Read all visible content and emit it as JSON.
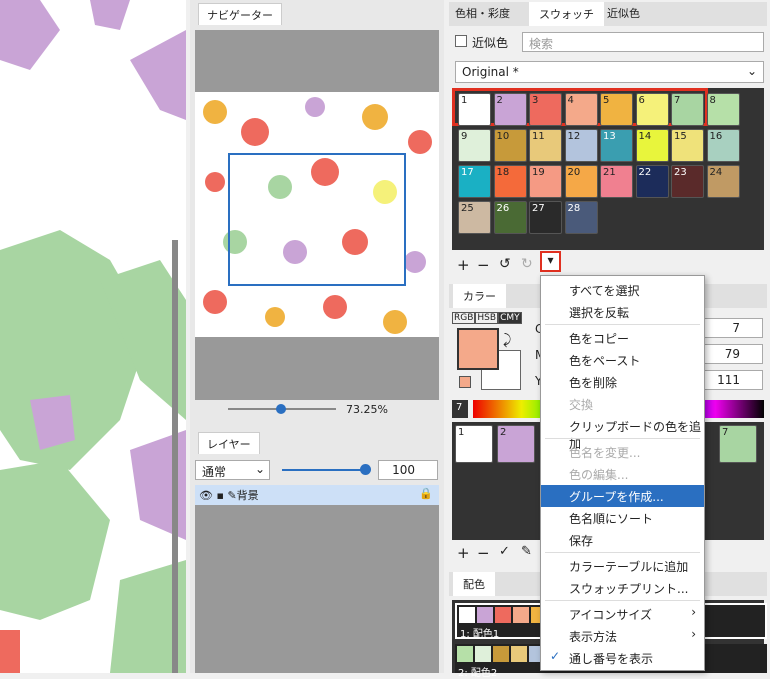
{
  "nav": {
    "tab": "ナビゲーター",
    "zoom": "73.25%"
  },
  "layer": {
    "tab": "レイヤー",
    "blend": "通常",
    "opacity": "100",
    "name": "背景"
  },
  "right_tabs": [
    "色相・彩度",
    "スウォッチ",
    "近似色"
  ],
  "approx": {
    "label": "近似色",
    "search_placeholder": "検索",
    "set": "Original *"
  },
  "swatches": [
    {
      "n": "1",
      "c": "#ffffff"
    },
    {
      "n": "2",
      "c": "#c9a4d6"
    },
    {
      "n": "3",
      "c": "#ee6a5e"
    },
    {
      "n": "4",
      "c": "#f4a98a"
    },
    {
      "n": "5",
      "c": "#f0b341"
    },
    {
      "n": "6",
      "c": "#f5f17a"
    },
    {
      "n": "7",
      "c": "#a8d5a2"
    },
    {
      "n": "8",
      "c": "#b6e0a8"
    },
    {
      "n": "9",
      "c": "#dff0da"
    },
    {
      "n": "10",
      "c": "#c79a3a"
    },
    {
      "n": "11",
      "c": "#e8c97a"
    },
    {
      "n": "12",
      "c": "#b3c4dd"
    },
    {
      "n": "13",
      "c": "#3a9eb0"
    },
    {
      "n": "14",
      "c": "#e8f53c"
    },
    {
      "n": "15",
      "c": "#efe27a"
    },
    {
      "n": "16",
      "c": "#a8d0c0"
    },
    {
      "n": "17",
      "c": "#1ab0c4"
    },
    {
      "n": "18",
      "c": "#f46a3a"
    },
    {
      "n": "19",
      "c": "#f59a84"
    },
    {
      "n": "20",
      "c": "#f5a847"
    },
    {
      "n": "21",
      "c": "#f08090"
    },
    {
      "n": "22",
      "c": "#1c2c5a"
    },
    {
      "n": "23",
      "c": "#5a2a2a"
    },
    {
      "n": "24",
      "c": "#c09a64"
    },
    {
      "n": "25",
      "c": "#cdb9a2"
    },
    {
      "n": "26",
      "c": "#4a6a34"
    },
    {
      "n": "27",
      "c": "#2a2a2a"
    },
    {
      "n": "28",
      "c": "#4a5a7a"
    }
  ],
  "color": {
    "tab": "カラー",
    "modes": [
      "RGB",
      "HSB",
      "CMY"
    ],
    "val1": "7",
    "val2": "79",
    "val3": "111",
    "label1": "C",
    "label2": "M",
    "label3": "Y",
    "seven": "7"
  },
  "recent": [
    {
      "n": "1",
      "c": "#ffffff"
    },
    {
      "n": "2",
      "c": "#c9a4d6"
    },
    {
      "n": "7",
      "c": "#a8d5a2"
    }
  ],
  "haishoku": {
    "tab": "配色",
    "row1": "1: 配色1",
    "row2": "2: 配色2"
  },
  "menu": [
    {
      "t": "すべてを選択",
      "s": ""
    },
    {
      "t": "選択を反転",
      "s": ""
    },
    {
      "t": "色をコピー",
      "s": ""
    },
    {
      "t": "色をペースト",
      "s": ""
    },
    {
      "t": "色を削除",
      "s": ""
    },
    {
      "t": "交換",
      "s": "dis"
    },
    {
      "t": "クリップボードの色を追加",
      "s": ""
    },
    {
      "t": "色名を変更...",
      "s": "dis"
    },
    {
      "t": "色の編集...",
      "s": "dis"
    },
    {
      "t": "グループを作成...",
      "s": "sel"
    },
    {
      "t": "色名順にソート",
      "s": ""
    },
    {
      "t": "保存",
      "s": ""
    },
    {
      "t": "カラーテーブルに追加",
      "s": ""
    },
    {
      "t": "スウォッチプリント...",
      "s": ""
    },
    {
      "t": "アイコンサイズ",
      "s": ""
    },
    {
      "t": "表示方法",
      "s": ""
    },
    {
      "t": "通し番号を表示",
      "s": ""
    }
  ]
}
